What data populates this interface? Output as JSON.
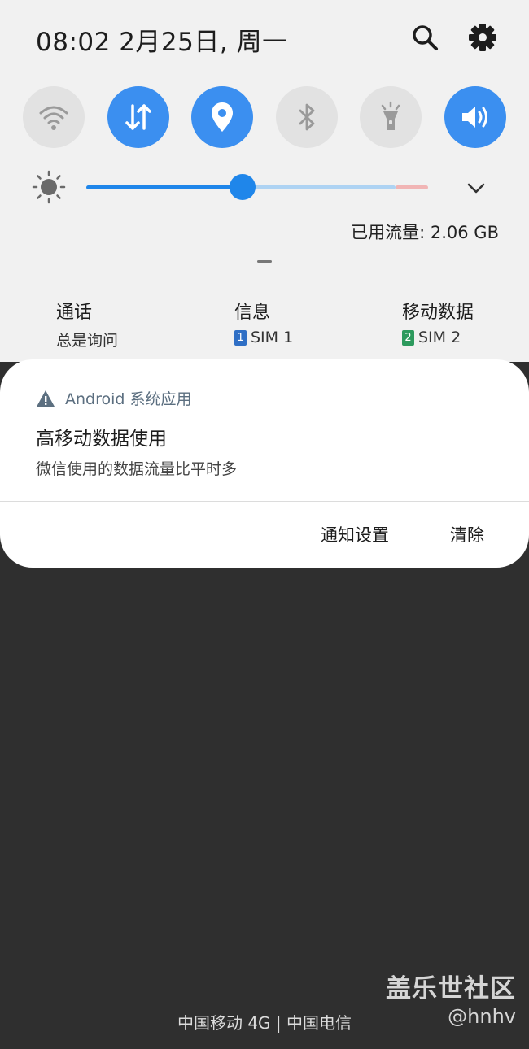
{
  "status": {
    "time_date": "08:02  2月25日, 周一"
  },
  "quick_settings": {
    "tiles": [
      {
        "name": "wifi",
        "active": false
      },
      {
        "name": "mobile-data",
        "active": true
      },
      {
        "name": "location",
        "active": true
      },
      {
        "name": "bluetooth",
        "active": false
      },
      {
        "name": "flashlight",
        "active": false
      },
      {
        "name": "sound",
        "active": true
      }
    ],
    "brightness_level": 0.46,
    "data_usage": "已用流量: 2.06 GB"
  },
  "sim": {
    "calls": {
      "title": "通话",
      "value": "总是询问"
    },
    "messages": {
      "title": "信息",
      "badge": "1",
      "value": "SIM 1"
    },
    "mobile_data": {
      "title": "移动数据",
      "badge": "2",
      "value": "SIM 2"
    }
  },
  "notification": {
    "app": "Android 系统应用",
    "title": "高移动数据使用",
    "body": "微信使用的数据流量比平时多",
    "actions": {
      "settings": "通知设置",
      "clear": "清除"
    }
  },
  "footer": {
    "carrier": "中国移动 4G | 中国电信"
  },
  "watermark": {
    "title": "盖乐世社区",
    "handle": "@hnhv"
  },
  "colors": {
    "accent": "#3b8ff0",
    "panel": "#f1f1f1",
    "background": "#2f2f2f"
  }
}
